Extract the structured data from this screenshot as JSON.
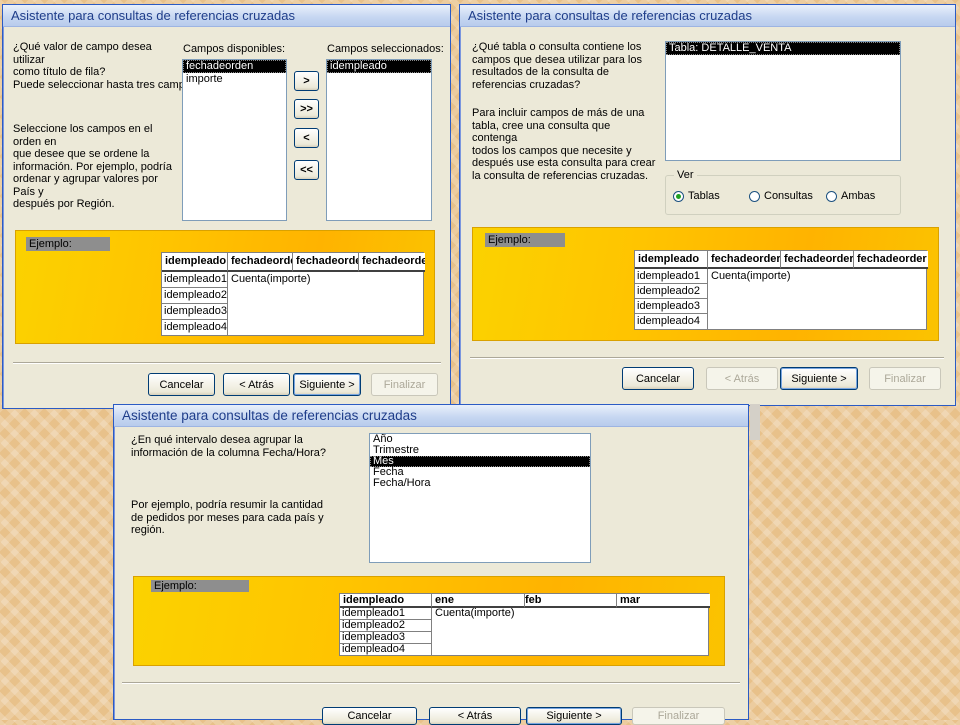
{
  "title": "Asistente para consultas de referencias cruzadas",
  "dialog1": {
    "question": [
      "¿Qué valor de campo desea utilizar",
      "como título de fila?"
    ],
    "hint": "Puede seleccionar hasta tres campos.",
    "order_note": [
      "Seleccione los campos en el orden en",
      "que desee que se ordene la",
      "información. Por ejemplo, podría",
      "ordenar y agrupar valores por País y",
      "después por Región."
    ],
    "available_label": "Campos disponibles:",
    "available_items": [
      "fechadeorden",
      "importe"
    ],
    "selected_label": "Campos seleccionados:",
    "selected_items": [
      "idempleado"
    ],
    "move_buttons": [
      ">",
      ">>",
      "<",
      "<<"
    ],
    "sample_label": "Ejemplo:",
    "grid": {
      "headers": [
        "idempleado",
        "fechadeorder",
        "fechadeorder",
        "fechadeorder"
      ],
      "rows": [
        "idempleado1",
        "idempleado2",
        "idempleado3",
        "idempleado4"
      ],
      "cell": "Cuenta(importe)"
    },
    "buttons": {
      "cancel": "Cancelar",
      "back": "< Atrás",
      "next": "Siguiente >",
      "finish": "Finalizar"
    }
  },
  "dialog2": {
    "question": [
      "¿Qué tabla o consulta contiene los",
      "campos que desea utilizar para los",
      "resultados de la consulta de",
      "referencias cruzadas?"
    ],
    "note": [
      "Para incluir campos de más de una",
      "tabla, cree una consulta que contenga",
      "todos los campos que necesite y",
      "después use esta consulta para crear",
      "la consulta de referencias cruzadas."
    ],
    "list_items": [
      "Tabla: DETALLE_VENTA"
    ],
    "view_group": "Ver",
    "view_options": [
      "Tablas",
      "Consultas",
      "Ambas"
    ],
    "view_selected": "Tablas",
    "sample_label": "Ejemplo:",
    "grid": {
      "headers": [
        "idempleado",
        "fechadeorder",
        "fechadeorder",
        "fechadeorder"
      ],
      "rows": [
        "idempleado1",
        "idempleado2",
        "idempleado3",
        "idempleado4"
      ],
      "cell": "Cuenta(importe)"
    },
    "buttons": {
      "cancel": "Cancelar",
      "back": "< Atrás",
      "next": "Siguiente >",
      "finish": "Finalizar"
    }
  },
  "dialog3": {
    "question": [
      "¿En qué intervalo desea agrupar la",
      "información de la columna Fecha/Hora?"
    ],
    "note": [
      "Por ejemplo, podría resumir la cantidad",
      "de pedidos por meses para cada país y",
      "región."
    ],
    "intervals": [
      "Año",
      "Trimestre",
      "Mes",
      "Fecha",
      "Fecha/Hora"
    ],
    "interval_selected": "Mes",
    "sample_label": "Ejemplo:",
    "grid": {
      "headers": [
        "idempleado",
        "ene",
        "feb",
        "mar"
      ],
      "rows": [
        "idempleado1",
        "idempleado2",
        "idempleado3",
        "idempleado4"
      ],
      "cell": "Cuenta(importe)"
    },
    "buttons": {
      "cancel": "Cancelar",
      "back": "< Atrás",
      "next": "Siguiente >",
      "finish": "Finalizar"
    }
  },
  "colors": {
    "sample_bg": "#ffc400",
    "selection": "#000000",
    "title_text": "#1f3d8a"
  }
}
